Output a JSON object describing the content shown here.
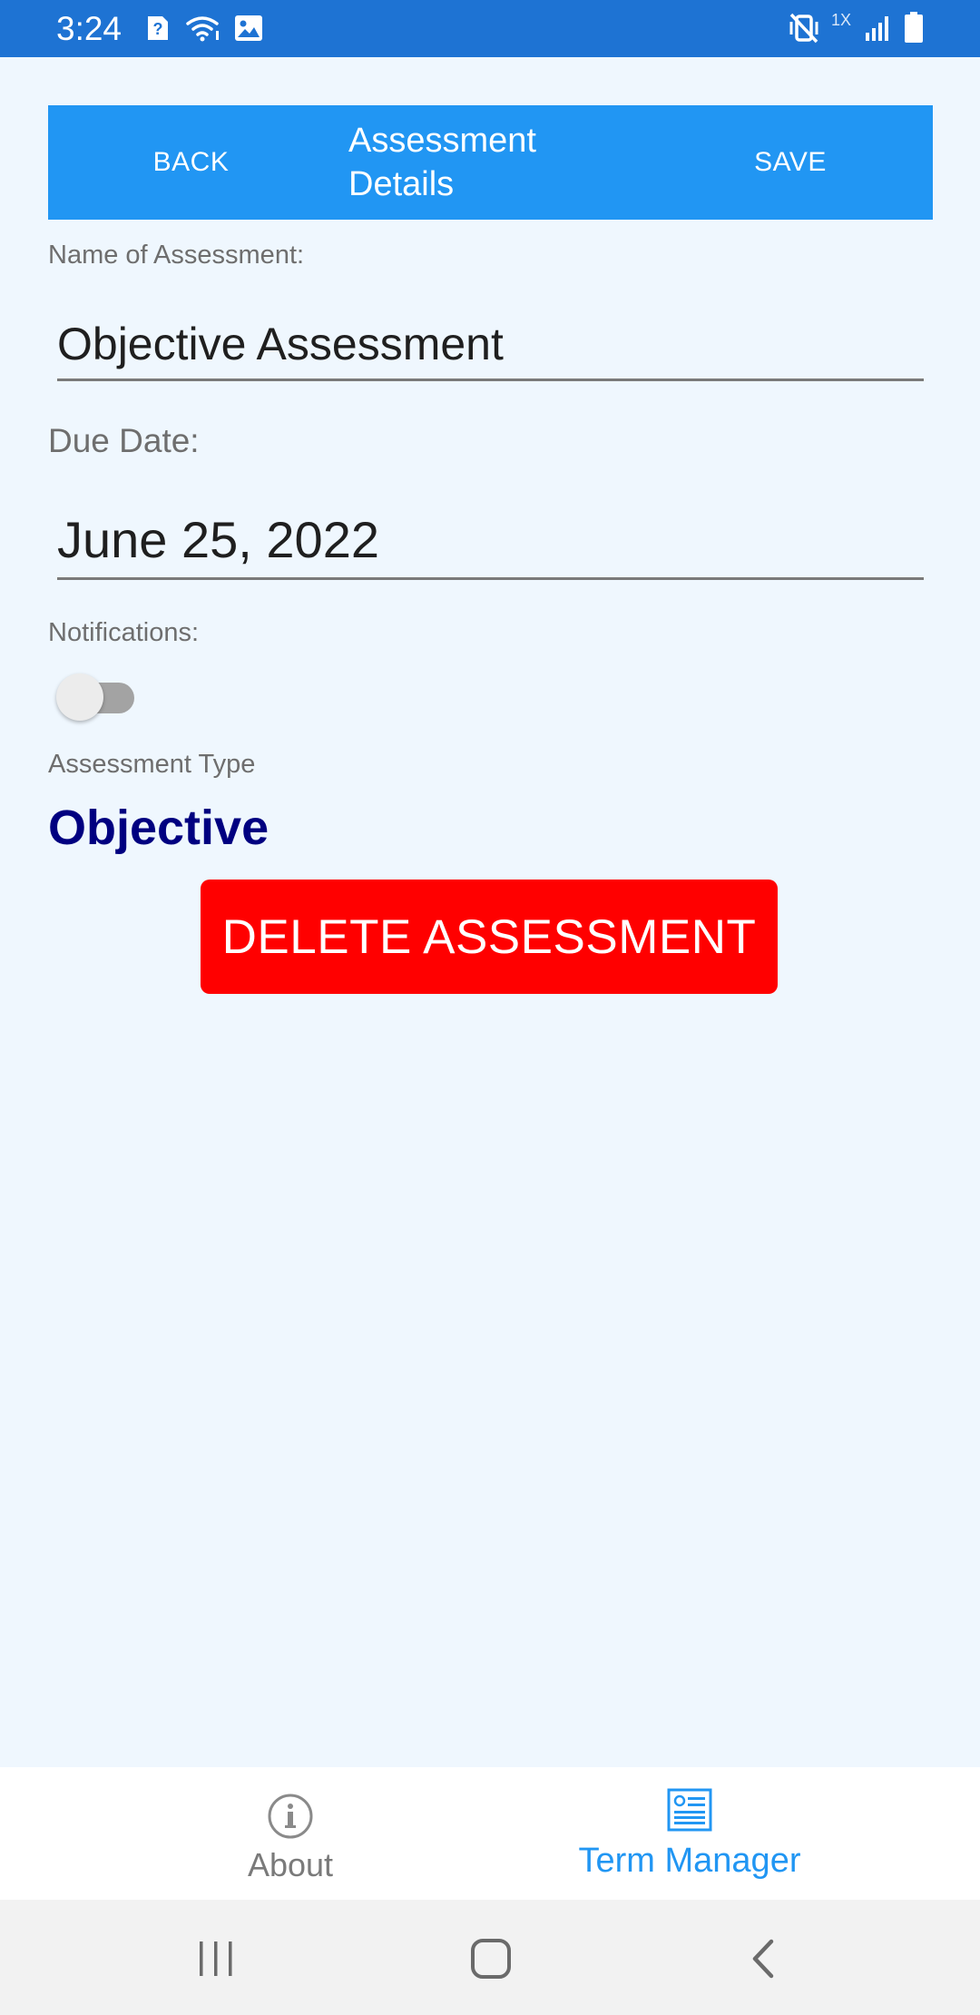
{
  "status_bar": {
    "time": "3:24",
    "icons": [
      "sim-question-icon",
      "wifi-icon",
      "image-icon",
      "vibrate-mute-icon",
      "signal-icon",
      "battery-icon"
    ],
    "network_badge": "1X"
  },
  "header": {
    "back_label": "BACK",
    "title_line1": "Assessment",
    "title_line2": "Details",
    "save_label": "SAVE"
  },
  "form": {
    "name_label": "Name of Assessment:",
    "name_value": "Objective Assessment",
    "due_label": "Due Date:",
    "due_value": "June 25, 2022",
    "notifications_label": "Notifications:",
    "notifications_on": false,
    "type_label": "Assessment Type",
    "type_value": "Objective"
  },
  "delete_button": {
    "label": "DELETE ASSESSMENT"
  },
  "tabs": [
    {
      "label": "About",
      "icon": "info-icon",
      "active": false
    },
    {
      "label": "Term Manager",
      "icon": "document-list-icon",
      "active": true
    }
  ],
  "colors": {
    "status_bar": "#1e73d3",
    "header": "#2196f3",
    "background": "#eff7fe",
    "type_value": "#000080",
    "delete": "#ff0000",
    "tab_active": "#2196f3",
    "tab_inactive": "#7a7a7a"
  }
}
